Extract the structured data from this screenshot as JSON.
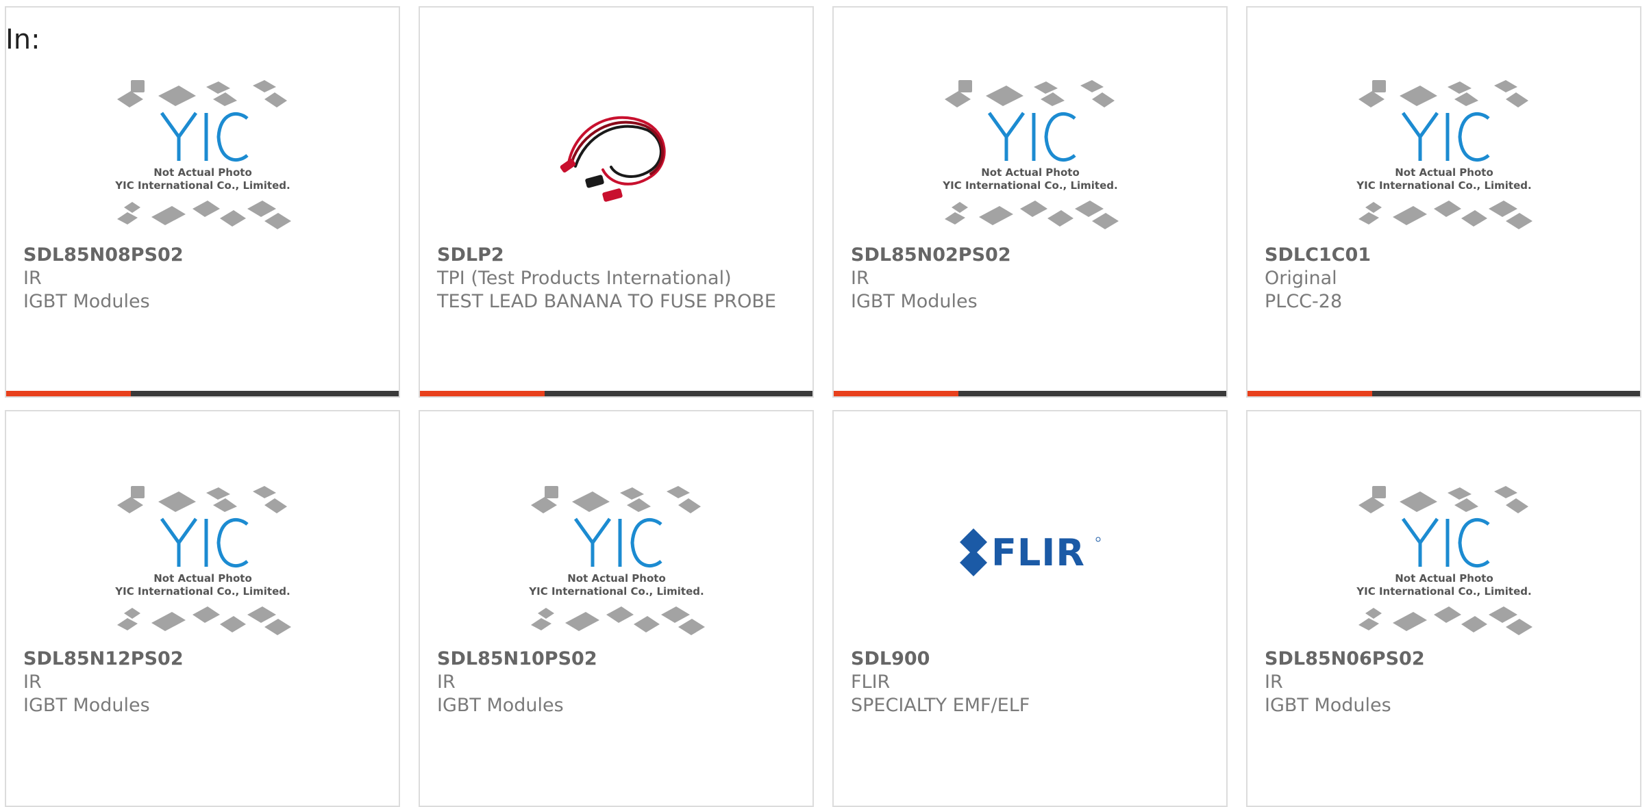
{
  "page": {
    "in_label": "In:"
  },
  "colors": {
    "accent": "#e8401c",
    "bar": "#3a3a3a",
    "yic_blue": "#1c8bd1",
    "flir_blue": "#1b5aa6"
  },
  "placeholder": {
    "line1": "Not Actual Photo",
    "line2": "YIC International Co., Limited.",
    "logo_text": "YIC"
  },
  "flir_logo_text": "FLIR",
  "products": [
    {
      "part": "SDL85N08PS02",
      "brand": "IR",
      "desc": "IGBT Modules",
      "image": "yic-placeholder-icon",
      "accent_bar": true
    },
    {
      "part": "SDLP2",
      "brand": "TPI (Test Products International)",
      "desc": "TEST LEAD BANANA TO FUSE PROBE",
      "image": "test-lead-photo-icon",
      "accent_bar": true
    },
    {
      "part": "SDL85N02PS02",
      "brand": "IR",
      "desc": "IGBT Modules",
      "image": "yic-placeholder-icon",
      "accent_bar": true
    },
    {
      "part": "SDLC1C01",
      "brand": "Original",
      "desc": "PLCC-28",
      "image": "yic-placeholder-icon",
      "accent_bar": true
    },
    {
      "part": "SDL85N12PS02",
      "brand": "IR",
      "desc": "IGBT Modules",
      "image": "yic-placeholder-icon",
      "accent_bar": false
    },
    {
      "part": "SDL85N10PS02",
      "brand": "IR",
      "desc": "IGBT Modules",
      "image": "yic-placeholder-icon",
      "accent_bar": false
    },
    {
      "part": "SDL900",
      "brand": "FLIR",
      "desc": "SPECIALTY EMF/ELF",
      "image": "flir-logo-icon",
      "accent_bar": false
    },
    {
      "part": "SDL85N06PS02",
      "brand": "IR",
      "desc": "IGBT Modules",
      "image": "yic-placeholder-icon",
      "accent_bar": false
    }
  ]
}
